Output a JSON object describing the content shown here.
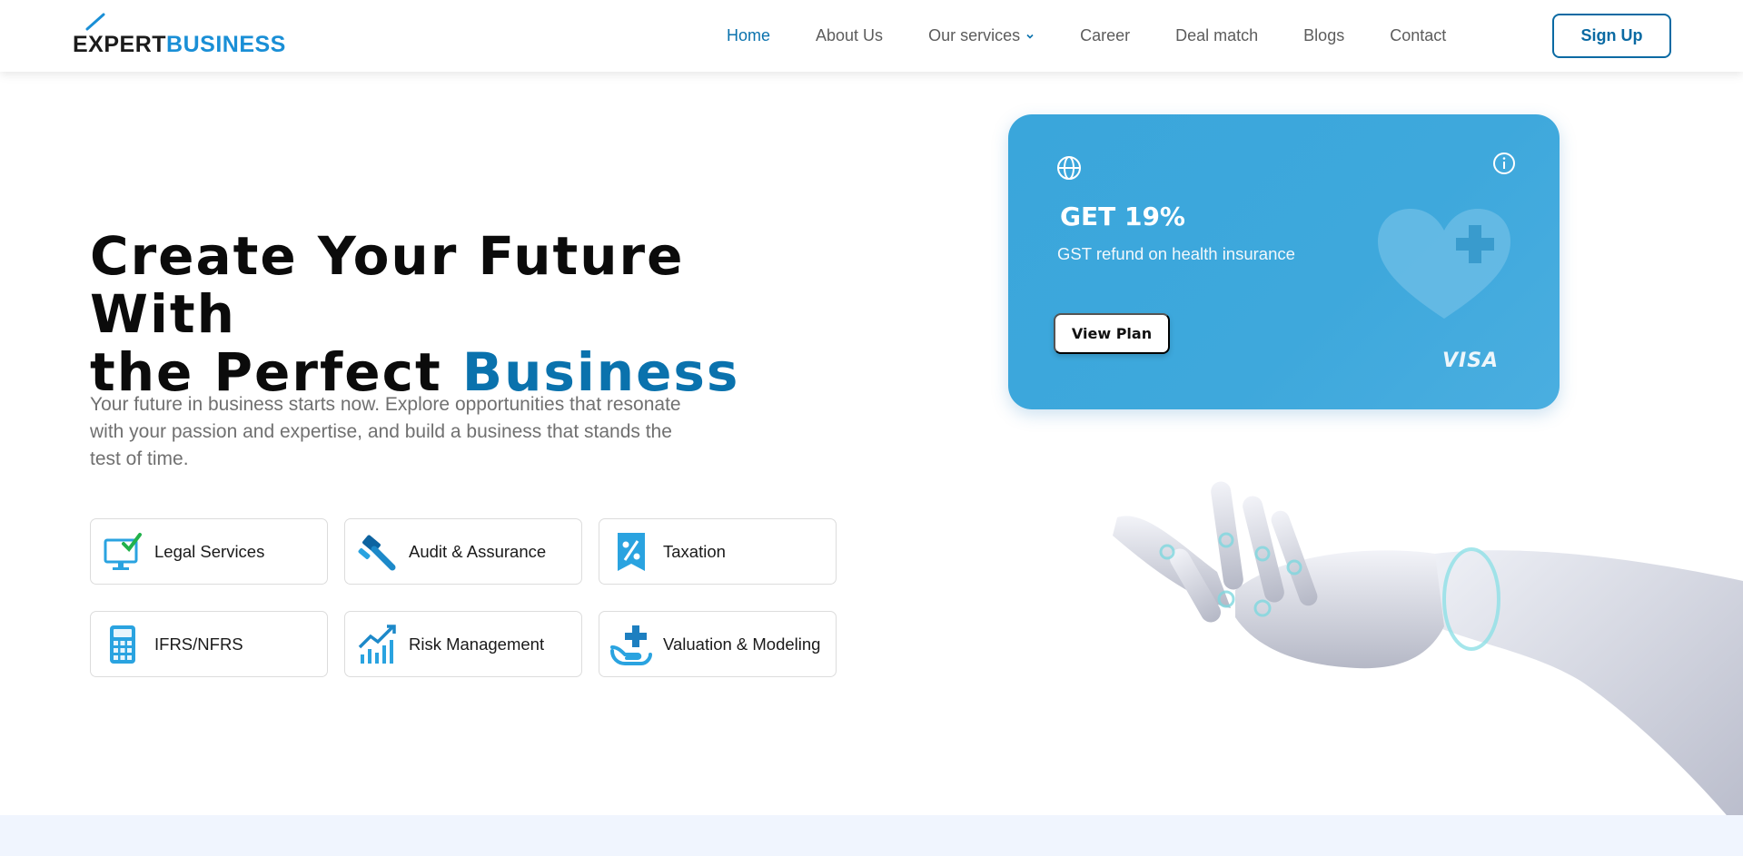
{
  "brand": {
    "part1": "EXPERT",
    "part2": "BUSINESS",
    "color_dark": "#1b1b1b",
    "color_accent": "#1a8fd6"
  },
  "nav": {
    "items": [
      {
        "label": "Home",
        "active": true
      },
      {
        "label": "About Us"
      },
      {
        "label": "Our services",
        "dropdown": true
      },
      {
        "label": "Career"
      },
      {
        "label": "Deal match"
      },
      {
        "label": "Blogs"
      },
      {
        "label": "Contact"
      }
    ],
    "signup_label": "Sign Up",
    "active_color": "#0a72ad"
  },
  "hero": {
    "title_line1": "Create Your Future With",
    "title_line2_prefix": "the Perfect ",
    "title_accent": "Business",
    "description": "Your future in business starts now. Explore opportunities that resonate with your passion and expertise, and build a business that stands the test of time."
  },
  "services": [
    {
      "label": "Legal Services",
      "icon": "monitor-check-icon"
    },
    {
      "label": "Audit & Assurance",
      "icon": "gavel-icon"
    },
    {
      "label": "Taxation",
      "icon": "percent-tag-icon"
    },
    {
      "label": "IFRS/NFRS",
      "icon": "calculator-icon"
    },
    {
      "label": "Risk Management",
      "icon": "growth-chart-icon"
    },
    {
      "label": "Valuation & Modeling",
      "icon": "medical-hand-icon"
    }
  ],
  "promo": {
    "headline": "GET 19%",
    "subtext": "GST refund on health insurance",
    "button": "View Plan",
    "card_brand": "VISA",
    "color": "#3ea8dc"
  }
}
